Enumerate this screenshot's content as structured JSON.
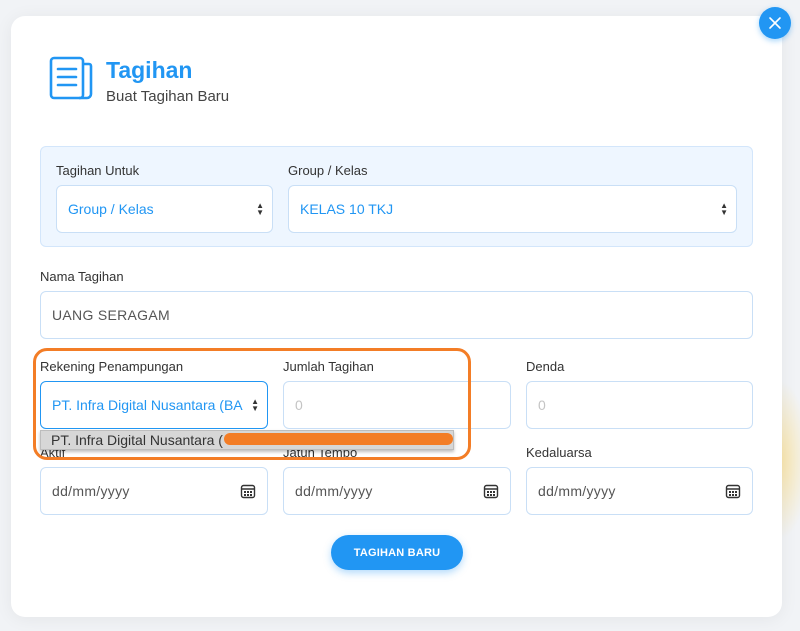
{
  "header": {
    "title": "Tagihan",
    "subtitle": "Buat Tagihan Baru",
    "icon": "document-list-icon"
  },
  "top_panel": {
    "tagihan_untuk": {
      "label": "Tagihan Untuk",
      "value": "Group / Kelas"
    },
    "group_kelas": {
      "label": "Group / Kelas",
      "value": "KELAS 10 TKJ"
    }
  },
  "nama_tagihan": {
    "label": "Nama Tagihan",
    "value": "UANG SERAGAM"
  },
  "rekening": {
    "label": "Rekening Penampungan",
    "value": "PT. Infra Digital Nusantara (BA",
    "dropdown_option": "PT. Infra Digital Nusantara ("
  },
  "jumlah_tagihan": {
    "label": "Jumlah Tagihan",
    "placeholder": "0"
  },
  "denda": {
    "label": "Denda",
    "placeholder": "0"
  },
  "aktif": {
    "label": "Aktif",
    "placeholder": "dd/mm/yyyy"
  },
  "jatuh_tempo": {
    "label": "Jatuh Tempo",
    "placeholder": "dd/mm/yyyy"
  },
  "kedaluarsa": {
    "label": "Kedaluarsa",
    "placeholder": "dd/mm/yyyy"
  },
  "submit": {
    "label": "TAGIHAN BARU"
  },
  "colors": {
    "accent": "#2196f3",
    "highlight": "#f37d26"
  }
}
